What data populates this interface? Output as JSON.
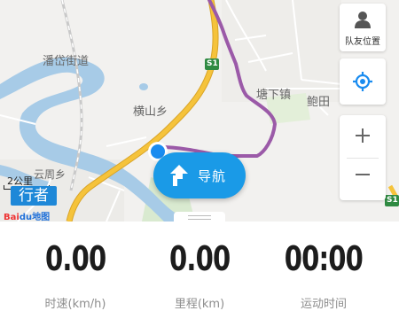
{
  "map": {
    "labels": {
      "panyu_street": "潘岱街道",
      "hengshan": "横山乡",
      "tangxia": "塘下镇",
      "baotian": "鲍田",
      "yunzhou": "云周乡",
      "road_s1_a": "S1",
      "road_s1_b": "S1"
    },
    "scale_text": "2公里",
    "brand_text": "行者",
    "baidu_text": "Bai",
    "baidu_du": "du地图",
    "colors": {
      "route": "#9b5aa8",
      "road": "#f0b82e",
      "water": "#a7cbe7",
      "location": "#1a8cf0"
    }
  },
  "side_buttons": {
    "teammate_label": "队友位置",
    "teammate_icon": "person-icon",
    "locate_icon": "locate-icon",
    "zoom_in_icon": "plus-icon",
    "zoom_out_icon": "minus-icon"
  },
  "navigate_button": {
    "label": "导航",
    "icon": "turn-arrow-icon",
    "color": "#1a9ae7"
  },
  "stats": [
    {
      "value": "0.00",
      "caption": "时速(km/h)"
    },
    {
      "value": "0.00",
      "caption": "里程(km)"
    },
    {
      "value": "00:00",
      "caption": "运动时间"
    }
  ]
}
